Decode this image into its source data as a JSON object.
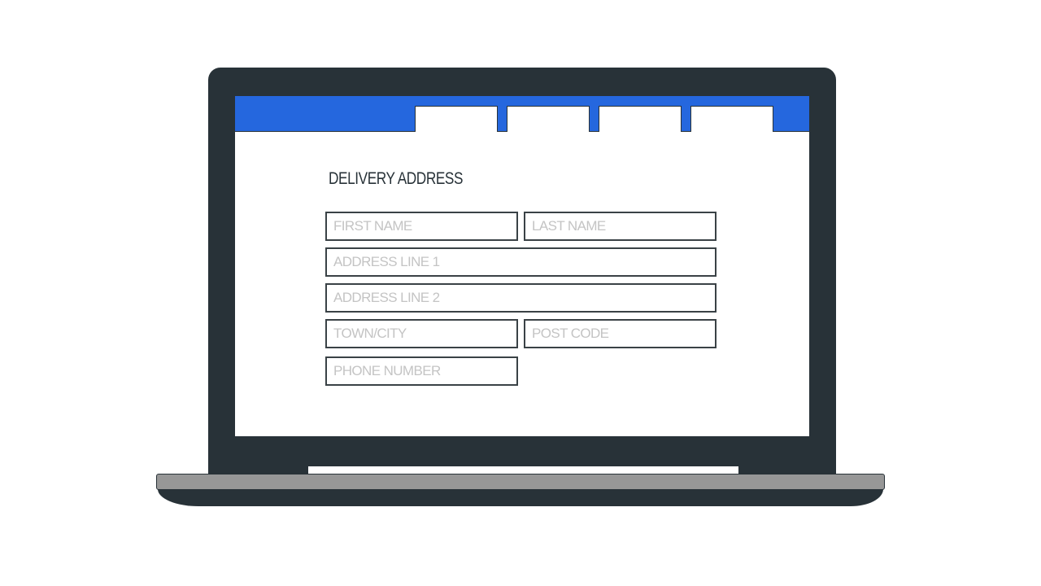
{
  "illustration": {
    "device": "laptop",
    "colors": {
      "frame": "#283238",
      "header_bar": "#2567de",
      "screen_bg": "#ffffff",
      "base": "#979797",
      "placeholder_text": "#c4c4c4"
    }
  },
  "header": {
    "nav_tabs": [
      {
        "label": ""
      },
      {
        "label": ""
      },
      {
        "label": ""
      },
      {
        "label": ""
      }
    ]
  },
  "form": {
    "title": "DELIVERY ADDRESS",
    "fields": {
      "first_name": {
        "placeholder": "FIRST NAME",
        "value": ""
      },
      "last_name": {
        "placeholder": "LAST NAME",
        "value": ""
      },
      "address_line_1": {
        "placeholder": "ADDRESS LINE 1",
        "value": ""
      },
      "address_line_2": {
        "placeholder": "ADDRESS LINE 2",
        "value": ""
      },
      "town_city": {
        "placeholder": "TOWN/CITY",
        "value": ""
      },
      "post_code": {
        "placeholder": "POST CODE",
        "value": ""
      },
      "phone_number": {
        "placeholder": "PHONE NUMBER",
        "value": ""
      }
    }
  }
}
